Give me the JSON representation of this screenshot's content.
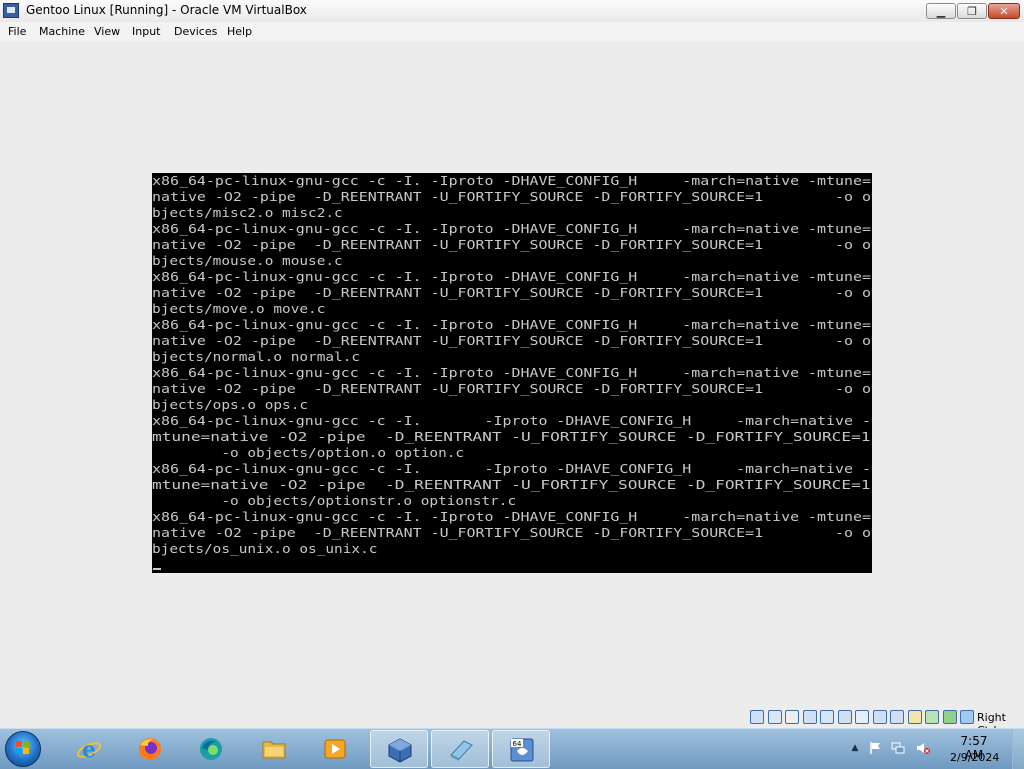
{
  "window": {
    "title": "Gentoo Linux [Running] - Oracle VM VirtualBox",
    "controls": {
      "minimize": "▁",
      "maximize": "❐",
      "close": "✕"
    }
  },
  "menu": [
    "File",
    "Machine",
    "View",
    "Input",
    "Devices",
    "Help"
  ],
  "console": {
    "lines": [
      "x86_64-pc-linux-gnu-gcc -c -I. -Iproto -DHAVE_CONFIG_H     -march=native -mtune=",
      "native -O2 -pipe  -D_REENTRANT -U_FORTIFY_SOURCE -D_FORTIFY_SOURCE=1        -o o",
      "bjects/misc2.o misc2.c",
      "x86_64-pc-linux-gnu-gcc -c -I. -Iproto -DHAVE_CONFIG_H     -march=native -mtune=",
      "native -O2 -pipe  -D_REENTRANT -U_FORTIFY_SOURCE -D_FORTIFY_SOURCE=1        -o o",
      "bjects/mouse.o mouse.c",
      "x86_64-pc-linux-gnu-gcc -c -I. -Iproto -DHAVE_CONFIG_H     -march=native -mtune=",
      "native -O2 -pipe  -D_REENTRANT -U_FORTIFY_SOURCE -D_FORTIFY_SOURCE=1        -o o",
      "bjects/move.o move.c",
      "x86_64-pc-linux-gnu-gcc -c -I. -Iproto -DHAVE_CONFIG_H     -march=native -mtune=",
      "native -O2 -pipe  -D_REENTRANT -U_FORTIFY_SOURCE -D_FORTIFY_SOURCE=1        -o o",
      "bjects/normal.o normal.c",
      "x86_64-pc-linux-gnu-gcc -c -I. -Iproto -DHAVE_CONFIG_H     -march=native -mtune=",
      "native -O2 -pipe  -D_REENTRANT -U_FORTIFY_SOURCE -D_FORTIFY_SOURCE=1        -o o",
      "bjects/ops.o ops.c",
      "x86_64-pc-linux-gnu-gcc -c -I.       -Iproto -DHAVE_CONFIG_H     -march=native -",
      "mtune=native -O2 -pipe  -D_REENTRANT -U_FORTIFY_SOURCE -D_FORTIFY_SOURCE=1",
      "        -o objects/option.o option.c",
      "x86_64-pc-linux-gnu-gcc -c -I.       -Iproto -DHAVE_CONFIG_H     -march=native -",
      "mtune=native -O2 -pipe  -D_REENTRANT -U_FORTIFY_SOURCE -D_FORTIFY_SOURCE=1",
      "        -o objects/optionstr.o optionstr.c",
      "x86_64-pc-linux-gnu-gcc -c -I. -Iproto -DHAVE_CONFIG_H     -march=native -mtune=",
      "native -O2 -pipe  -D_REENTRANT -U_FORTIFY_SOURCE -D_FORTIFY_SOURCE=1        -o o",
      "bjects/os_unix.o os_unix.c"
    ]
  },
  "status_bar": {
    "icons": [
      "hard-disk-icon",
      "optical-drive-icon",
      "floppy-icon",
      "audio-icon",
      "network-icon",
      "usb-icon",
      "shared-folders-icon",
      "display-icon",
      "video-capture-icon",
      "cpu-virtualization-icon",
      "guest-additions-icon",
      "mouse-integration-icon",
      "keyboard-capture-icon"
    ],
    "host_key": "Right Ctrl"
  },
  "taskbar": {
    "apps": [
      {
        "name": "internet-explorer",
        "active": false
      },
      {
        "name": "firefox",
        "active": false
      },
      {
        "name": "edge",
        "active": false
      },
      {
        "name": "file-explorer",
        "active": false
      },
      {
        "name": "media-player",
        "active": false
      },
      {
        "name": "virtualbox",
        "active": true
      },
      {
        "name": "notes-app",
        "active": true
      },
      {
        "name": "virtualbox-vm",
        "active": true
      }
    ],
    "vm_badge": "64",
    "clock": {
      "time": "7:57 AM",
      "date": "2/9/2024"
    }
  },
  "colors": {
    "console_bg": "#000000",
    "console_fg": "#c8c8c8",
    "taskbar": "#7aa5cc"
  }
}
